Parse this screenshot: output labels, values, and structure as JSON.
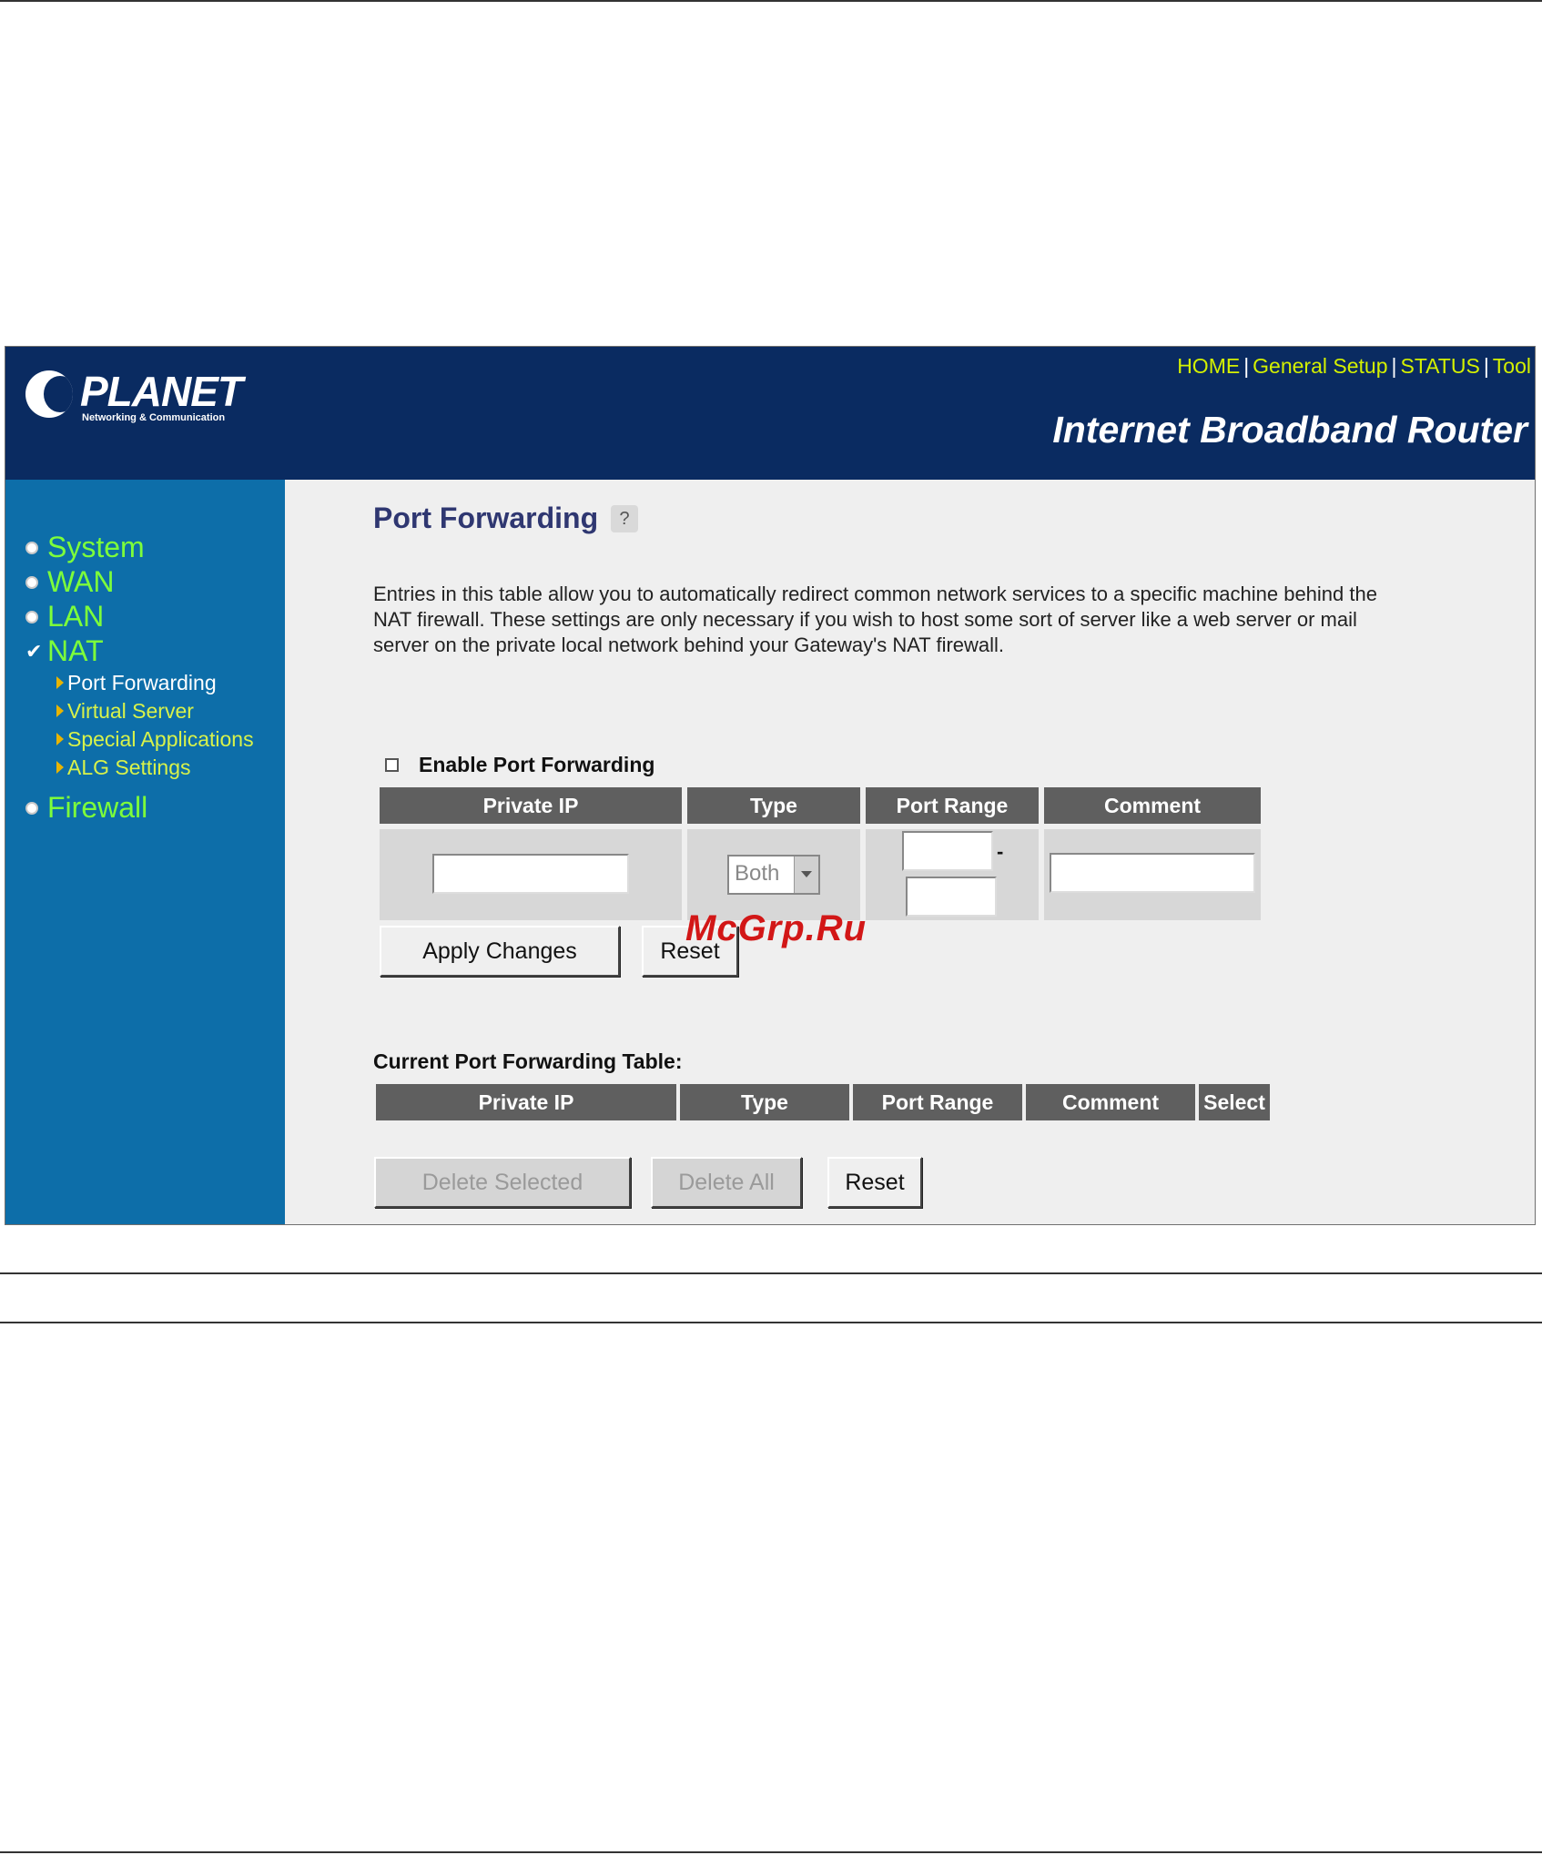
{
  "header": {
    "logo_text": "PLANET",
    "logo_subtitle": "Networking & Communication",
    "nav": [
      "HOME",
      "General Setup",
      "STATUS",
      "Tool"
    ],
    "product_title": "Internet Broadband Router"
  },
  "sidebar": {
    "items": [
      {
        "label": "System",
        "state": "bullet"
      },
      {
        "label": "WAN",
        "state": "bullet"
      },
      {
        "label": "LAN",
        "state": "bullet"
      },
      {
        "label": "NAT",
        "state": "checked"
      },
      {
        "label": "Firewall",
        "state": "bullet"
      }
    ],
    "nat_subitems": [
      "Port Forwarding",
      "Virtual Server",
      "Special Applications",
      "ALG Settings"
    ]
  },
  "main": {
    "title": "Port Forwarding",
    "description": "Entries in this table allow you to automatically redirect common network services to a specific machine behind the NAT firewall. These settings are only necessary if you wish to host some sort of server like a web server or mail server on the private local network behind your Gateway's NAT firewall.",
    "enable_label": "Enable Port Forwarding",
    "enable_checked": false,
    "form_headers": [
      "Private IP",
      "Type",
      "Port Range",
      "Comment"
    ],
    "form": {
      "private_ip": "",
      "type": "Both",
      "port_from": "",
      "port_sep": "-",
      "port_to": "",
      "comment": ""
    },
    "apply_label": "Apply Changes",
    "reset_label": "Reset",
    "current_table_title": "Current Port Forwarding Table:",
    "current_headers": [
      "Private IP",
      "Type",
      "Port Range",
      "Comment",
      "Select"
    ],
    "current_rows": [],
    "delete_selected_label": "Delete Selected",
    "delete_all_label": "Delete All",
    "reset2_label": "Reset"
  },
  "watermark": "McGrp.Ru"
}
